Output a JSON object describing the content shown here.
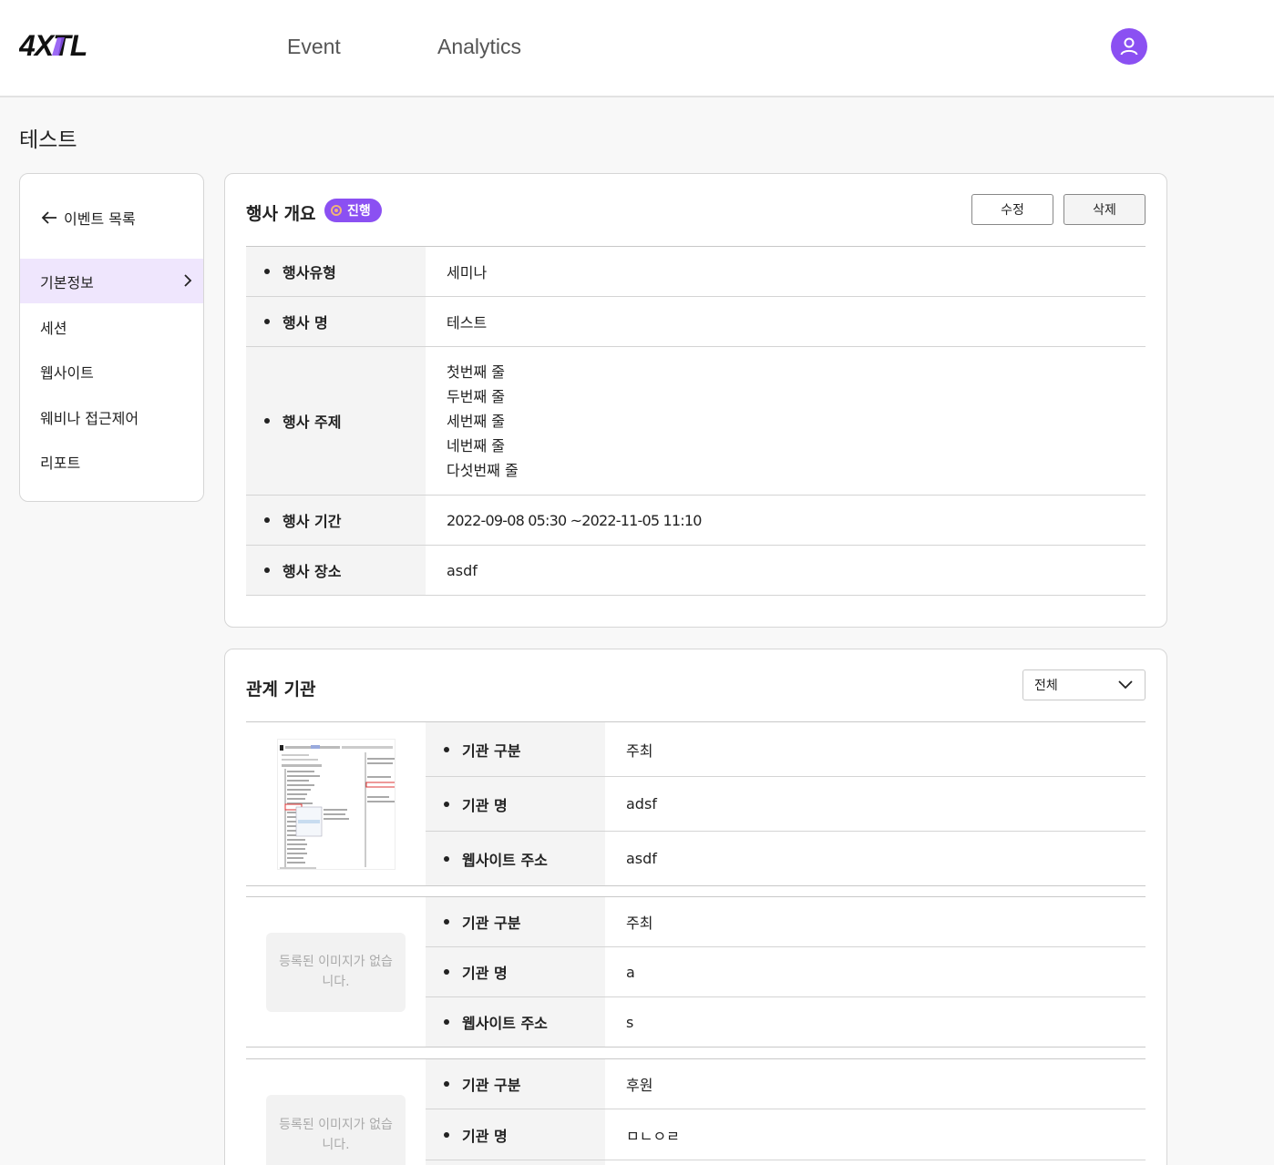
{
  "header": {
    "logo_text": "4XTL",
    "nav": [
      "Event",
      "Analytics"
    ],
    "avatar_icon": "user-icon",
    "brand_color": "#8b50f2"
  },
  "page": {
    "title": "테스트"
  },
  "sidebar": {
    "back_label": "이벤트 목록",
    "items": [
      {
        "label": "기본정보",
        "active": true
      },
      {
        "label": "세션"
      },
      {
        "label": "웹사이트"
      },
      {
        "label": "웨비나 접근제어"
      },
      {
        "label": "리포트"
      }
    ]
  },
  "overview": {
    "title": "행사 개요",
    "status_badge": "진행",
    "edit_label": "수정",
    "delete_label": "삭제",
    "fields": {
      "type_label": "행사유형",
      "type_value": "세미나",
      "name_label": "행사 명",
      "name_value": "테스트",
      "topic_label": "행사 주제",
      "topic_lines": [
        "첫번째 줄",
        "두번째 줄",
        "세번째 줄",
        "네번째 줄",
        "다섯번째 줄"
      ],
      "period_label": "행사 기간",
      "period_value": "2022-09-08 05:30 ~2022-11-05 11:10",
      "place_label": "행사 장소",
      "place_value": "asdf"
    }
  },
  "orgs": {
    "title": "관계 기관",
    "filter_value": "전체",
    "labels": {
      "category": "기관 구분",
      "name": "기관 명",
      "website": "웹사이트 주소"
    },
    "no_image": "등록된 이미지가 없습니다.",
    "items": [
      {
        "category": "주최",
        "name": "adsf",
        "website": "asdf"
      },
      {
        "category": "주최",
        "name": "a",
        "website": "s"
      },
      {
        "category": "후원",
        "name": "ㅁㄴㅇㄹ"
      }
    ]
  }
}
